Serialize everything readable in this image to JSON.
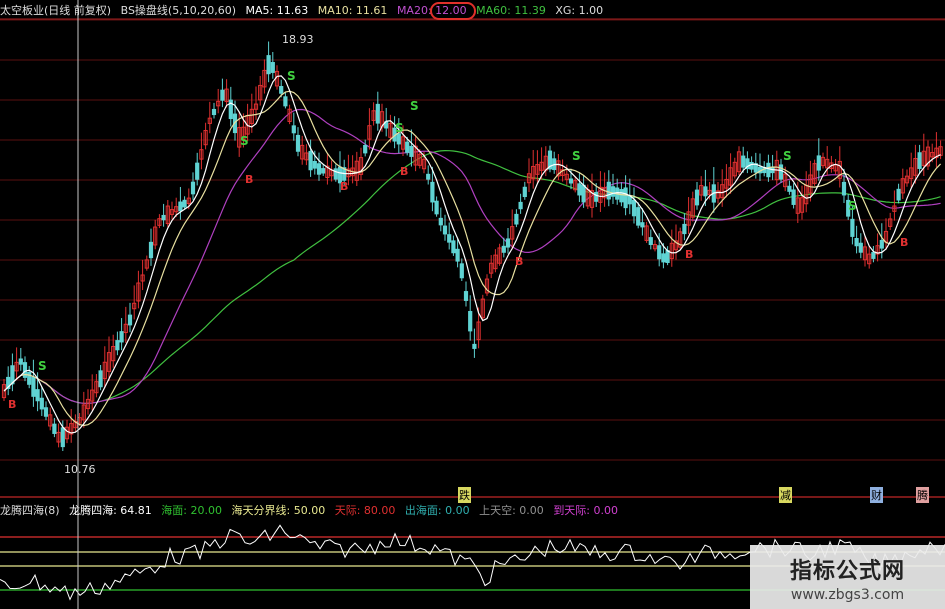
{
  "top_header": {
    "name": "太空板业(日线 前复权)",
    "indicator": "BS操盘线(5,10,20,60)",
    "ma5": "MA5: 11.63",
    "ma10": "MA10: 11.61",
    "ma20": "MA20: 12.00",
    "ma60": "MA60: 11.39",
    "xg": "XG: 1.00"
  },
  "bottom_header": {
    "name": "龙腾四海(8)",
    "ltsh": "龙腾四海: 64.81",
    "haimian": "海面: 20.00",
    "fenjie": "海天分界线: 50.00",
    "tianjie": "天际: 80.00",
    "chuhai": "出海面: 0.00",
    "shangtian": "上天空: 0.00",
    "daotian": "到天际: 0.00"
  },
  "annotations": {
    "high": "18.93",
    "low": "10.76",
    "s": "S",
    "b": "B"
  },
  "markers": [
    "跌",
    "减",
    "财",
    "腾"
  ],
  "watermark": {
    "line1": "指标公式网",
    "line2": "www.zbgs3.com"
  },
  "colors": {
    "up": "#e03030",
    "down": "#5fd3d3",
    "ma5": "#ffffff",
    "ma10": "#e8e0a0",
    "ma20": "#b040c0",
    "ma60": "#40c040",
    "grid": "#5a1010",
    "haimian": "#30c030",
    "fenjie": "#e8e890",
    "tianjie": "#e03030",
    "chuhai": "#30b0b0",
    "shangtian": "#909090",
    "daotian": "#d040d0",
    "ltsh": "#ffffff"
  }
}
